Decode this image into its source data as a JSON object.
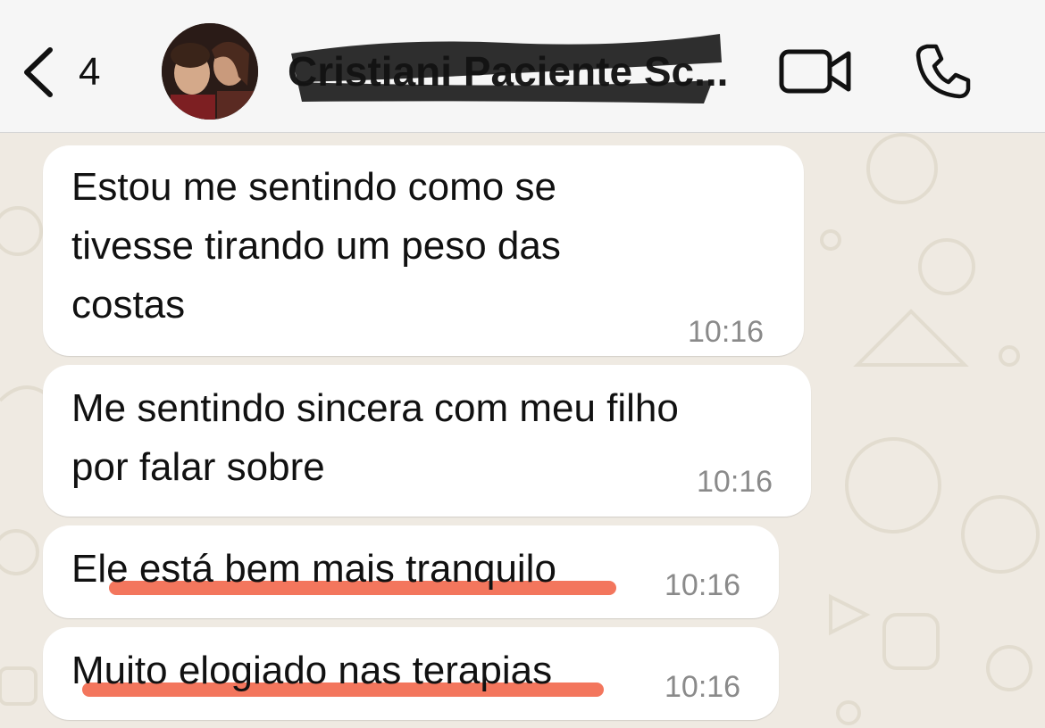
{
  "header": {
    "back_count": "4",
    "contact_name": "Cristiani Paciente Sc...",
    "icons": {
      "back": "chevron-left-icon",
      "video": "video-camera-icon",
      "call": "phone-icon"
    }
  },
  "messages": [
    {
      "lines": [
        "Estou me sentindo como se",
        "tivesse tirando um peso das",
        "costas"
      ],
      "time": "10:16",
      "highlighted": false
    },
    {
      "lines": [
        "Me sentindo sincera com meu filho",
        "por falar sobre"
      ],
      "time": "10:16",
      "highlighted": false
    },
    {
      "lines": [
        "Ele está bem mais tranquilo"
      ],
      "time": "10:16",
      "highlighted": true
    },
    {
      "lines": [
        "Muito elogiado nas terapias"
      ],
      "time": "10:16",
      "highlighted": true
    }
  ],
  "colors": {
    "bubble": "#ffffff",
    "chat_background": "#efeae2",
    "highlight": "#f26a4f",
    "timestamp": "#8a8a8a"
  }
}
